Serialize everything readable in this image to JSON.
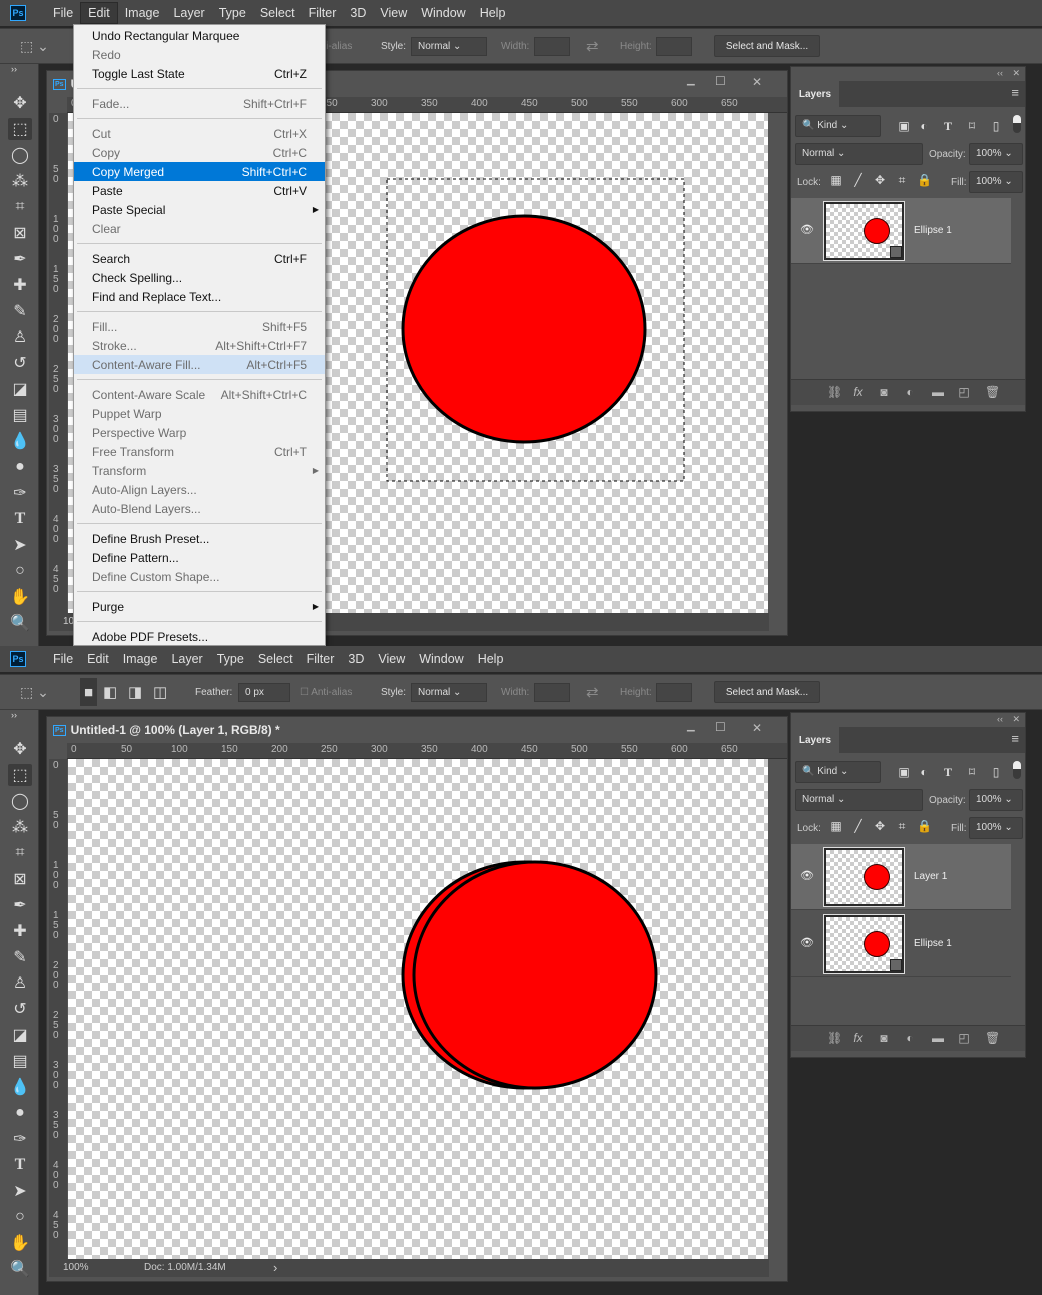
{
  "menubar": [
    "File",
    "Edit",
    "Image",
    "Layer",
    "Type",
    "Select",
    "Filter",
    "3D",
    "View",
    "Window",
    "Help"
  ],
  "logo": "Ps",
  "colors": {
    "accent": "#31a8ff",
    "highlight": "#0078d7",
    "ellipse_fill": "#ff0000",
    "ellipse_stroke": "#000000"
  },
  "options": {
    "feather_label": "Feather:",
    "feather_value": "0 px",
    "antialias_label": "Anti-alias",
    "style_label": "Style:",
    "style_value": "Normal",
    "width_label": "Width:",
    "height_label": "Height:",
    "select_mask": "Select and Mask..."
  },
  "tools": [
    "move-icon",
    "rectangular-marquee-icon",
    "lasso-icon",
    "magic-wand-icon",
    "crop-icon",
    "frame-icon",
    "eyedropper-icon",
    "healing-brush-icon",
    "brush-icon",
    "clone-stamp-icon",
    "history-brush-icon",
    "eraser-icon",
    "gradient-icon",
    "blur-icon",
    "dodge-icon",
    "pen-icon",
    "type-icon",
    "path-selection-icon",
    "ellipse-icon",
    "hand-icon",
    "zoom-icon"
  ],
  "ruler": {
    "top": [
      "0",
      "50",
      "100",
      "150",
      "200",
      "250",
      "300",
      "350",
      "400",
      "450",
      "500",
      "550",
      "600",
      "650"
    ],
    "left": [
      "0",
      "5\n0",
      "1\n0\n0",
      "1\n5\n0",
      "2\n0\n0",
      "2\n5\n0",
      "3\n0\n0",
      "3\n5\n0",
      "4\n0\n0",
      "4\n5\n0"
    ]
  },
  "layers_panel": {
    "tab": "Layers",
    "filter_kind": "Kind",
    "blend_mode": "Normal",
    "opacity_label": "Opacity:",
    "opacity_value": "100%",
    "lock_label": "Lock:",
    "fill_label": "Fill:",
    "fill_value": "100%"
  },
  "screens": [
    {
      "active_menu": "Edit",
      "doc_title": "Untitled-1 @ 100% (Layer 1, RGB/8) *",
      "zoom": "100%",
      "doc_info": "Doc: 1.00M/1.34M",
      "layers": [
        {
          "name": "Ellipse 1",
          "selected": true,
          "shape": true
        }
      ],
      "edit_menu": [
        {
          "label": "Undo Rectangular Marquee",
          "shortcut": ""
        },
        {
          "label": "Redo",
          "shortcut": "",
          "disabled": true
        },
        {
          "label": "Toggle Last State",
          "shortcut": "Ctrl+Z"
        },
        {
          "sep": true
        },
        {
          "label": "Fade...",
          "shortcut": "Shift+Ctrl+F",
          "disabled": true
        },
        {
          "sep": true
        },
        {
          "label": "Cut",
          "shortcut": "Ctrl+X",
          "disabled": true
        },
        {
          "label": "Copy",
          "shortcut": "Ctrl+C",
          "disabled": true
        },
        {
          "label": "Copy Merged",
          "shortcut": "Shift+Ctrl+C",
          "highlighted": true
        },
        {
          "label": "Paste",
          "shortcut": "Ctrl+V"
        },
        {
          "label": "Paste Special",
          "shortcut": "",
          "submenu": true
        },
        {
          "label": "Clear",
          "shortcut": "",
          "disabled": true
        },
        {
          "sep": true
        },
        {
          "label": "Search",
          "shortcut": "Ctrl+F"
        },
        {
          "label": "Check Spelling...",
          "shortcut": ""
        },
        {
          "label": "Find and Replace Text...",
          "shortcut": ""
        },
        {
          "sep": true
        },
        {
          "label": "Fill...",
          "shortcut": "Shift+F5",
          "disabled": true
        },
        {
          "label": "Stroke...",
          "shortcut": "Alt+Shift+Ctrl+F7",
          "disabled": true
        },
        {
          "label": "Content-Aware Fill...",
          "shortcut": "Alt+Ctrl+F5",
          "disabled": true,
          "hover": true
        },
        {
          "sep": true
        },
        {
          "label": "Content-Aware Scale",
          "shortcut": "Alt+Shift+Ctrl+C",
          "disabled": true
        },
        {
          "label": "Puppet Warp",
          "shortcut": "",
          "disabled": true
        },
        {
          "label": "Perspective Warp",
          "shortcut": "",
          "disabled": true
        },
        {
          "label": "Free Transform",
          "shortcut": "Ctrl+T",
          "disabled": true
        },
        {
          "label": "Transform",
          "shortcut": "",
          "disabled": true,
          "submenu": true
        },
        {
          "label": "Auto-Align Layers...",
          "shortcut": "",
          "disabled": true
        },
        {
          "label": "Auto-Blend Layers...",
          "shortcut": "",
          "disabled": true
        },
        {
          "sep": true
        },
        {
          "label": "Define Brush Preset...",
          "shortcut": ""
        },
        {
          "label": "Define Pattern...",
          "shortcut": ""
        },
        {
          "label": "Define Custom Shape...",
          "shortcut": "",
          "disabled": true
        },
        {
          "sep": true
        },
        {
          "label": "Purge",
          "shortcut": "",
          "submenu": true
        },
        {
          "sep": true
        },
        {
          "label": "Adobe PDF Presets...",
          "shortcut": ""
        }
      ]
    },
    {
      "active_menu": "",
      "doc_title": "Untitled-1 @ 100% (Layer 1, RGB/8) *",
      "zoom": "100%",
      "doc_info": "Doc: 1.00M/1.34M",
      "layers": [
        {
          "name": "Layer 1",
          "selected": true,
          "shape": false
        },
        {
          "name": "Ellipse 1",
          "selected": false,
          "shape": true
        }
      ]
    }
  ]
}
